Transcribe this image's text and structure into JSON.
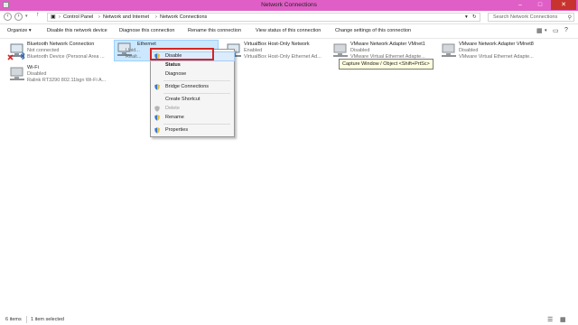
{
  "window": {
    "title": "Network Connections"
  },
  "address": {
    "crumbs": [
      "Control Panel",
      "Network and Internet",
      "Network Connections"
    ],
    "separator": "›",
    "search_placeholder": "Search Network Connections"
  },
  "toolbar": {
    "organize": "Organize ▾",
    "disable": "Disable this network device",
    "diagnose": "Diagnose this connection",
    "rename": "Rename this connection",
    "view_status": "View status of this connection",
    "change_settings": "Change settings of this connection"
  },
  "connections": [
    {
      "name": "Bluetooth Network Connection",
      "status": "Not connected",
      "device": "Bluetooth Device (Personal Area ..."
    },
    {
      "name": "Ethernet",
      "status": "Unid...",
      "device": "Realt..."
    },
    {
      "name": "VirtualBox Host-Only Network",
      "status": "Enabled",
      "device": "VirtualBox Host-Only Ethernet Ad..."
    },
    {
      "name": "VMware Network Adapter VMnet1",
      "status": "Disabled",
      "device": "VMware Virtual Ethernet Adapte..."
    },
    {
      "name": "VMware Network Adapter VMnet8",
      "status": "Disabled",
      "device": "VMware Virtual Ethernet Adapte..."
    },
    {
      "name": "Wi-Fi",
      "status": "Disabled",
      "device": "Ralink RT3290 802.11bgn Wi-Fi A..."
    }
  ],
  "context_menu": {
    "disable": "Disable",
    "status": "Status",
    "diagnose": "Diagnose",
    "bridge": "Bridge Connections",
    "shortcut": "Create Shortcut",
    "delete": "Delete",
    "rename": "Rename",
    "properties": "Properties"
  },
  "tooltip": "Capture Window / Object <Shift+PrtSc>",
  "status_bar": {
    "count": "6 items",
    "selected": "1 item selected"
  },
  "colors": {
    "titlebar": "#e05fc6",
    "close": "#c7332e",
    "selection": "#cce8ff",
    "highlight_box": "#d42525"
  }
}
